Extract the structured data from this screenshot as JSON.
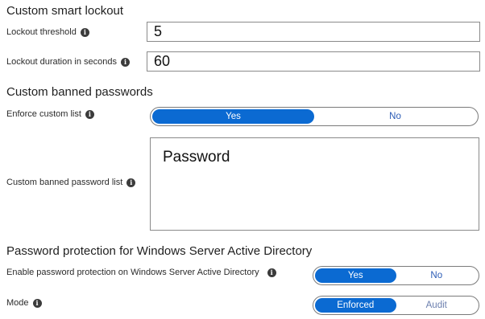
{
  "smart_lockout": {
    "heading": "Custom smart lockout",
    "threshold_label": "Lockout threshold",
    "threshold_value": "5",
    "duration_label": "Lockout duration in seconds",
    "duration_value": "60"
  },
  "banned_passwords": {
    "heading": "Custom banned passwords",
    "enforce_label": "Enforce custom list",
    "enforce_options": [
      "Yes",
      "No"
    ],
    "enforce_selected": "Yes",
    "list_label": "Custom banned password list",
    "list_value": "Password"
  },
  "password_protection": {
    "heading": "Password protection for Windows Server Active Directory",
    "enable_label": "Enable password protection on Windows Server Active Directory",
    "enable_options": [
      "Yes",
      "No"
    ],
    "enable_selected": "Yes",
    "mode_label": "Mode",
    "mode_options": [
      "Enforced",
      "Audit"
    ],
    "mode_selected": "Enforced"
  },
  "colors": {
    "accent": "#0b6ad2",
    "unselected_text": "#2a5bb5"
  },
  "icons": {
    "info": "info-icon"
  }
}
